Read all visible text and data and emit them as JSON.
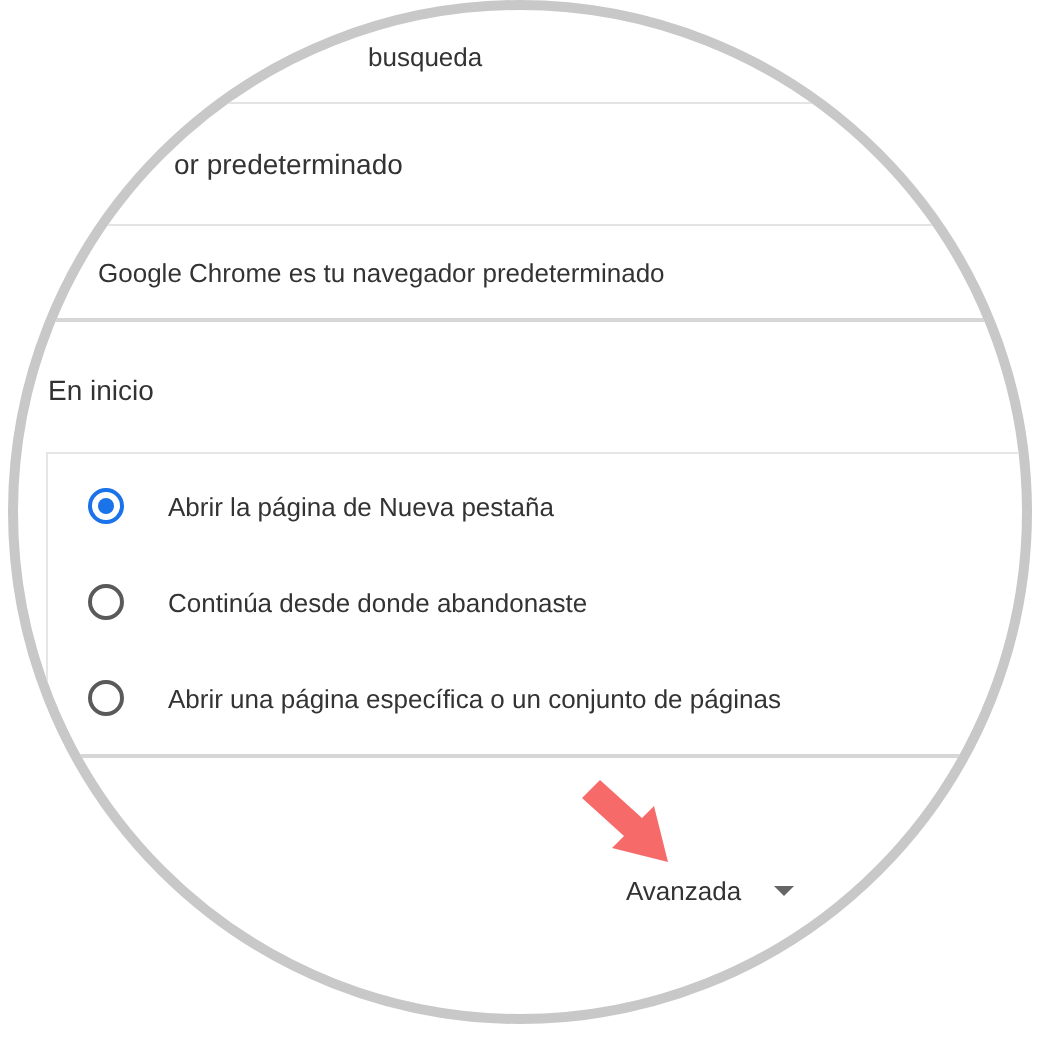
{
  "sections": [
    {
      "kind": "row",
      "text": "busqueda"
    },
    {
      "kind": "heading",
      "text": "or predeterminado"
    },
    {
      "kind": "row",
      "text": "Google Chrome es tu navegador predeterminado"
    }
  ],
  "startup": {
    "title": "En inicio",
    "options": [
      {
        "label": "Abrir la página de Nueva pestaña",
        "selected": true
      },
      {
        "label": "Continúa desde donde abandonaste",
        "selected": false
      },
      {
        "label": "Abrir una página específica o un conjunto de páginas",
        "selected": false
      }
    ]
  },
  "advanced": {
    "label": "Avanzada"
  }
}
